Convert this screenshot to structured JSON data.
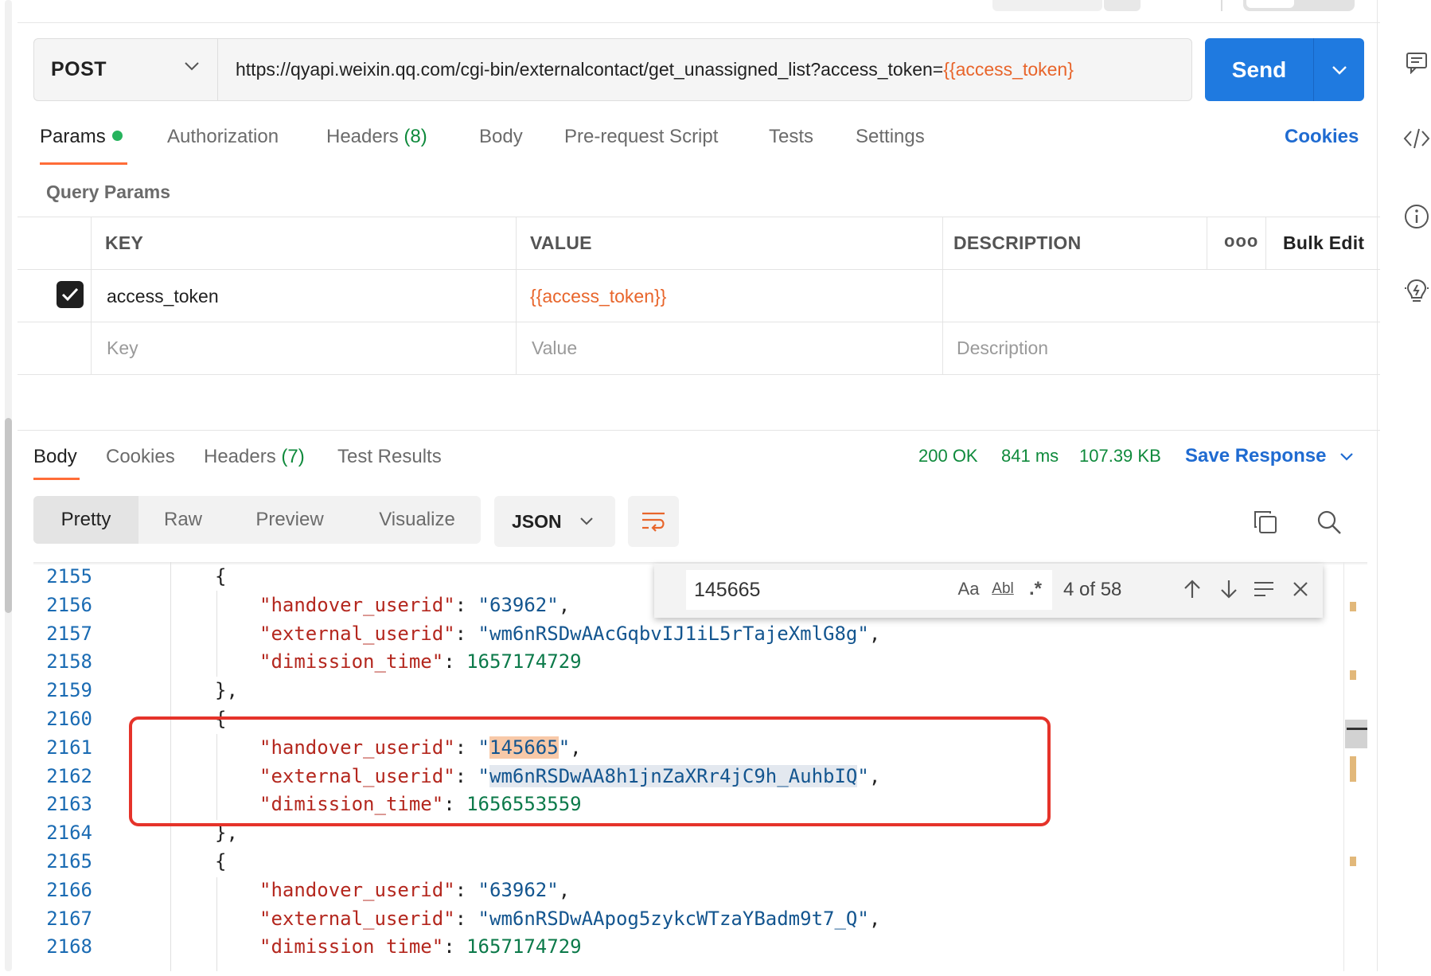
{
  "request": {
    "method": "POST",
    "url_prefix": "https://qyapi.weixin.qq.com/cgi-bin/externalcontact/get_unassigned_list?access_token=",
    "url_var": "{{access_token}",
    "send_label": "Send"
  },
  "request_tabs": [
    {
      "label": "Params",
      "active": true
    },
    {
      "label": "Authorization"
    },
    {
      "label": "Headers",
      "count": "(8)"
    },
    {
      "label": "Body"
    },
    {
      "label": "Pre-request Script"
    },
    {
      "label": "Tests"
    },
    {
      "label": "Settings"
    }
  ],
  "cookies_label": "Cookies",
  "query_params": {
    "title": "Query Params",
    "headers": {
      "key": "KEY",
      "value": "VALUE",
      "description": "DESCRIPTION",
      "more": "ooo",
      "bulk_edit": "Bulk Edit"
    },
    "rows": [
      {
        "checked": true,
        "key": "access_token",
        "value": "{{access_token}}",
        "description": ""
      }
    ],
    "placeholders": {
      "key": "Key",
      "value": "Value",
      "description": "Description"
    }
  },
  "response_tabs": [
    {
      "label": "Body",
      "active": true
    },
    {
      "label": "Cookies"
    },
    {
      "label": "Headers",
      "count": "(7)"
    },
    {
      "label": "Test Results"
    }
  ],
  "response_status": {
    "status": "200 OK",
    "time": "841 ms",
    "size": "107.39 KB",
    "save_label": "Save Response"
  },
  "view_modes": [
    "Pretty",
    "Raw",
    "Preview",
    "Visualize"
  ],
  "format": "JSON",
  "find": {
    "query": "145665",
    "match_case": "Aa",
    "whole_word": "Abl",
    "regex": ".*",
    "count": "4 of 58"
  },
  "code": {
    "line_numbers": [
      "2155",
      "2156",
      "2157",
      "2158",
      "2159",
      "2160",
      "2161",
      "2162",
      "2163",
      "2164",
      "2165",
      "2166",
      "2167",
      "2168"
    ],
    "lines": [
      {
        "indent": 2,
        "text": "{"
      },
      {
        "indent": 3,
        "key": "\"handover_userid\"",
        "sep": ": ",
        "str": "\"63962\"",
        "end": ","
      },
      {
        "indent": 3,
        "key": "\"external_userid\"",
        "sep": ": ",
        "str": "\"wm6nRSDwAAcGqbvIJ1iL5rTajeXmlG8g\"",
        "end": ","
      },
      {
        "indent": 3,
        "key": "\"dimission_time\"",
        "sep": ": ",
        "num": "1657174729"
      },
      {
        "indent": 2,
        "text": "},"
      },
      {
        "indent": 2,
        "text": "{"
      },
      {
        "indent": 3,
        "key": "\"handover_userid\"",
        "sep": ": ",
        "str_pre": "\"",
        "match": "145665",
        "str_post": "\"",
        "end": ","
      },
      {
        "indent": 3,
        "key": "\"external_userid\"",
        "sep": ": ",
        "str_pre": "\"",
        "sel": "wm6nRSDwAA8h1jnZaXRr4jC9h_AuhbIQ",
        "str_post": "\"",
        "end": ","
      },
      {
        "indent": 3,
        "key": "\"dimission_time\"",
        "sep": ": ",
        "num": "1656553559"
      },
      {
        "indent": 2,
        "text": "},"
      },
      {
        "indent": 2,
        "text": "{"
      },
      {
        "indent": 3,
        "key": "\"handover_userid\"",
        "sep": ": ",
        "str": "\"63962\"",
        "end": ","
      },
      {
        "indent": 3,
        "key": "\"external_userid\"",
        "sep": ": ",
        "str": "\"wm6nRSDwAApog5zykcWTzaYBadm9t7_Q\"",
        "end": ","
      },
      {
        "indent": 3,
        "key": "\"dimission time\"",
        "sep": ": ",
        "num": "1657174729"
      }
    ]
  },
  "icons": [
    "comment-icon",
    "code-icon",
    "info-icon",
    "bulb-icon",
    "copy-icon",
    "search-icon",
    "wrap-icon",
    "chevron-down-icon",
    "check-icon",
    "arrow-up-icon",
    "arrow-down-icon",
    "find-selection-icon",
    "close-icon"
  ],
  "colors": {
    "accent": "#ff6c37",
    "send": "#1f7ae0",
    "link": "#1f6bd1",
    "status_green": "#0f8a3c",
    "variable": "#e8652b",
    "highlight_box": "#e5332a"
  }
}
